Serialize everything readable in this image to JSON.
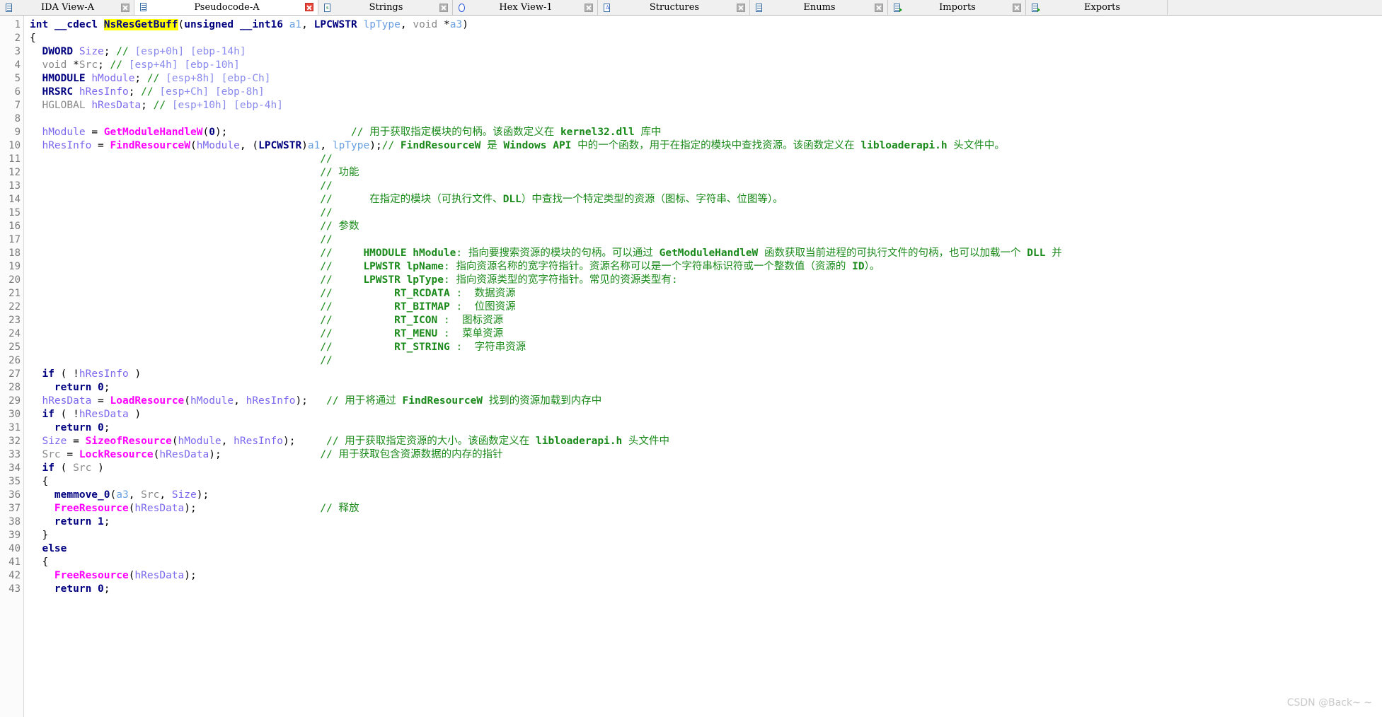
{
  "window": {
    "app": "IDA Pro",
    "watermark": "CSDN @Back~ ~"
  },
  "tabs": [
    {
      "label": "IDA View-A",
      "icon": "document-icon",
      "active": false,
      "close": "close-icon",
      "close_style": "gray"
    },
    {
      "label": "Pseudocode-A",
      "icon": "pseudocode-icon",
      "active": true,
      "close": "close-icon",
      "close_style": "red"
    },
    {
      "label": "Strings",
      "icon": "strings-icon",
      "active": false,
      "close": "close-icon",
      "close_style": "gray"
    },
    {
      "label": "Hex View-1",
      "icon": "hex-view-icon",
      "active": false,
      "close": "close-icon",
      "close_style": "gray"
    },
    {
      "label": "Structures",
      "icon": "structures-icon",
      "active": false,
      "close": "close-icon",
      "close_style": "gray"
    },
    {
      "label": "Enums",
      "icon": "enums-icon",
      "active": false,
      "close": "close-icon",
      "close_style": "gray"
    },
    {
      "label": "Imports",
      "icon": "imports-icon",
      "active": false,
      "close": "close-icon",
      "close_style": "gray"
    },
    {
      "label": "Exports",
      "icon": "exports-icon",
      "active": false,
      "close": "",
      "close_style": ""
    }
  ],
  "editor": {
    "function_name": "NsResGetBuff",
    "highlighted_token": "NsResGetBuff",
    "first_line": 1,
    "last_line": 43,
    "line_numbers": [
      1,
      2,
      3,
      4,
      5,
      6,
      7,
      8,
      9,
      10,
      11,
      12,
      13,
      14,
      15,
      16,
      17,
      18,
      19,
      20,
      21,
      22,
      23,
      24,
      25,
      26,
      27,
      28,
      29,
      30,
      31,
      32,
      33,
      34,
      35,
      36,
      37,
      38,
      39,
      40,
      41,
      42,
      43
    ],
    "colors": {
      "keyword": "#000080",
      "api_function": "#ff00ff",
      "local_variable": "#7b68ee",
      "argument": "#6aa0e0",
      "comment": "#1a8a1a",
      "stack_offset": "#8a8aee",
      "highlight_background": "#ffff00",
      "background": "#ffffff",
      "gutter_text": "#7a7a7a"
    },
    "lines": [
      {
        "n": 1,
        "text": "int __cdecl NsResGetBuff(unsigned __int16 a1, LPCWSTR lpType, void *a3)"
      },
      {
        "n": 2,
        "text": "{"
      },
      {
        "n": 3,
        "text": "  DWORD Size; // [esp+0h] [ebp-14h]"
      },
      {
        "n": 4,
        "text": "  void *Src; // [esp+4h] [ebp-10h]"
      },
      {
        "n": 5,
        "text": "  HMODULE hModule; // [esp+8h] [ebp-Ch]"
      },
      {
        "n": 6,
        "text": "  HRSRC hResInfo; // [esp+Ch] [ebp-8h]"
      },
      {
        "n": 7,
        "text": "  HGLOBAL hResData; // [esp+10h] [ebp-4h]"
      },
      {
        "n": 8,
        "text": ""
      },
      {
        "n": 9,
        "text": "  hModule = GetModuleHandleW(0);                    // 用于获取指定模块的句柄。该函数定义在 kernel32.dll 库中"
      },
      {
        "n": 10,
        "text": "  hResInfo = FindResourceW(hModule, (LPCWSTR)a1, lpType);// FindResourceW 是 Windows API 中的一个函数，用于在指定的模块中查找资源。该函数定义在 libloaderapi.h 头文件中。"
      },
      {
        "n": 11,
        "text": "                                               //"
      },
      {
        "n": 12,
        "text": "                                               // 功能"
      },
      {
        "n": 13,
        "text": "                                               //"
      },
      {
        "n": 14,
        "text": "                                               //      在指定的模块（可执行文件、DLL）中查找一个特定类型的资源（图标、字符串、位图等）。"
      },
      {
        "n": 15,
        "text": "                                               //"
      },
      {
        "n": 16,
        "text": "                                               // 参数"
      },
      {
        "n": 17,
        "text": "                                               //"
      },
      {
        "n": 18,
        "text": "                                               //     HMODULE hModule: 指向要搜索资源的模块的句柄。可以通过 GetModuleHandleW 函数获取当前进程的可执行文件的句柄，也可以加载一个 DLL 并"
      },
      {
        "n": 19,
        "text": "                                               //     LPWSTR lpName: 指向资源名称的宽字符指针。资源名称可以是一个字符串标识符或一个整数值（资源的 ID）。"
      },
      {
        "n": 20,
        "text": "                                               //     LPWSTR lpType: 指向资源类型的宽字符指针。常见的资源类型有:"
      },
      {
        "n": 21,
        "text": "                                               //          RT_RCDATA :  数据资源"
      },
      {
        "n": 22,
        "text": "                                               //          RT_BITMAP :  位图资源"
      },
      {
        "n": 23,
        "text": "                                               //          RT_ICON :  图标资源"
      },
      {
        "n": 24,
        "text": "                                               //          RT_MENU :  菜单资源"
      },
      {
        "n": 25,
        "text": "                                               //          RT_STRING :  字符串资源"
      },
      {
        "n": 26,
        "text": "                                               //"
      },
      {
        "n": 27,
        "text": "  if ( !hResInfo )"
      },
      {
        "n": 28,
        "text": "    return 0;"
      },
      {
        "n": 29,
        "text": "  hResData = LoadResource(hModule, hResInfo);   // 用于将通过 FindResourceW 找到的资源加载到内存中"
      },
      {
        "n": 30,
        "text": "  if ( !hResData )"
      },
      {
        "n": 31,
        "text": "    return 0;"
      },
      {
        "n": 32,
        "text": "  Size = SizeofResource(hModule, hResInfo);     // 用于获取指定资源的大小。该函数定义在 libloaderapi.h 头文件中"
      },
      {
        "n": 33,
        "text": "  Src = LockResource(hResData);                // 用于获取包含资源数据的内存的指针"
      },
      {
        "n": 34,
        "text": "  if ( Src )"
      },
      {
        "n": 35,
        "text": "  {"
      },
      {
        "n": 36,
        "text": "    memmove_0(a3, Src, Size);"
      },
      {
        "n": 37,
        "text": "    FreeResource(hResData);                    // 释放"
      },
      {
        "n": 38,
        "text": "    return 1;"
      },
      {
        "n": 39,
        "text": "  }"
      },
      {
        "n": 40,
        "text": "  else"
      },
      {
        "n": 41,
        "text": "  {"
      },
      {
        "n": 42,
        "text": "    FreeResource(hResData);"
      },
      {
        "n": 43,
        "text": "    return 0;"
      }
    ]
  }
}
